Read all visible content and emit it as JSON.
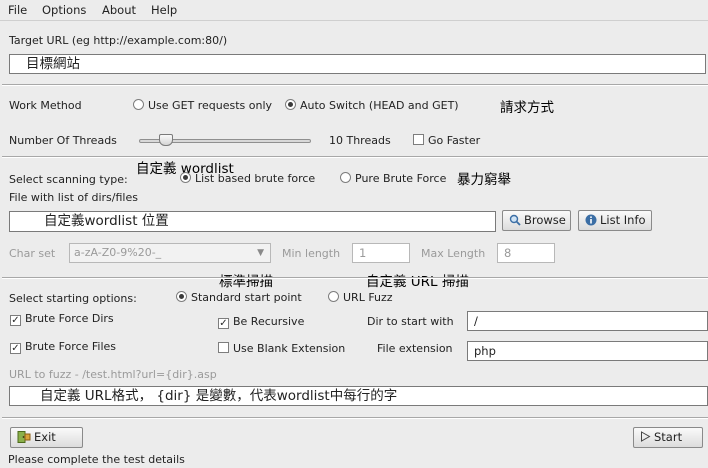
{
  "menu": [
    "File",
    "Options",
    "About",
    "Help"
  ],
  "target": {
    "label": "Target URL (eg http://example.com:80/)",
    "value": "目標網站"
  },
  "work_method": {
    "label": "Work Method",
    "option_get": "Use GET requests only",
    "option_auto": "Auto Switch (HEAD and GET)",
    "selected": "auto",
    "note": "請求方式"
  },
  "threads": {
    "label": "Number Of Threads",
    "value": 10,
    "max": 100,
    "value_label": "10 Threads",
    "go_faster_label": "Go Faster",
    "go_faster_checked": false
  },
  "scanning": {
    "note_wordlist": "自定義 wordlist",
    "label": "Select scanning type:",
    "option_list": "List based brute force",
    "option_pure": "Pure Brute Force",
    "selected": "list",
    "note_pure": "暴力窮舉"
  },
  "file_list": {
    "label": "File with list of dirs/files",
    "value": "自定義wordlist 位置",
    "browse_label": "Browse",
    "list_info_label": "List Info"
  },
  "charset": {
    "label": "Char set",
    "value": "a-zA-Z0-9%20-_",
    "min_label": "Min length",
    "min_value": "1",
    "max_label": "Max Length",
    "max_value": "8"
  },
  "notes_mid": {
    "standard": "標準掃描",
    "url": "自定義 URL 掃描"
  },
  "start_options": {
    "label": "Select starting options:",
    "option_standard": "Standard start point",
    "option_fuzz": "URL Fuzz",
    "selected": "standard"
  },
  "brute_dirs": {
    "label": "Brute Force Dirs",
    "checked": true
  },
  "recursive": {
    "label": "Be Recursive",
    "checked": true
  },
  "dir_start": {
    "label": "Dir to start with",
    "value": "/"
  },
  "brute_files": {
    "label": "Brute Force Files",
    "checked": true
  },
  "blank_ext": {
    "label": "Use Blank Extension",
    "checked": false
  },
  "file_ext": {
    "label": "File extension",
    "value": "php"
  },
  "fuzz": {
    "label": "URL to fuzz - /test.html?url={dir}.asp",
    "value": "自定義 URL格式， {dir} 是變數，代表wordlist中每行的字"
  },
  "exit_label": "Exit",
  "start_label": "Start",
  "status": "Please complete the test details",
  "colors": {
    "window_bg": "#ececec",
    "border": "#7a7a7a"
  }
}
